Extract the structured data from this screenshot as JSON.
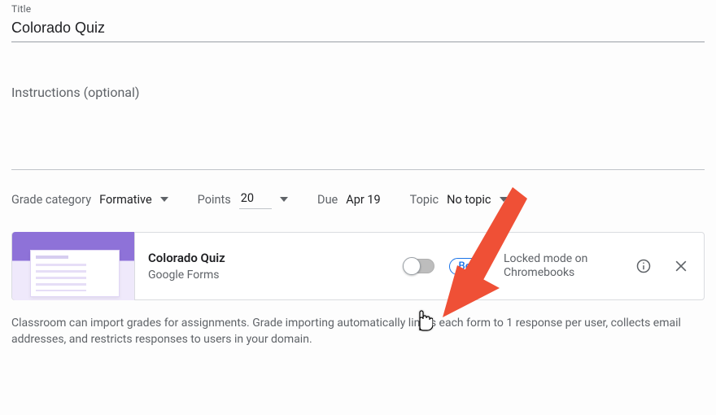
{
  "title": {
    "label": "Title",
    "value": "Colorado Quiz"
  },
  "instructions": {
    "placeholder": "Instructions (optional)"
  },
  "meta": {
    "gradeCategory": {
      "label": "Grade category",
      "value": "Formative"
    },
    "points": {
      "label": "Points",
      "value": "20"
    },
    "due": {
      "label": "Due",
      "value": "Apr 19"
    },
    "topic": {
      "label": "Topic",
      "value": "No topic"
    }
  },
  "attachment": {
    "title": "Colorado Quiz",
    "subtitle": "Google Forms",
    "betaBadge": "Beta",
    "lockedModeLabel": "Locked mode on Chromebooks"
  },
  "helpText": "Classroom can import grades for assignments. Grade importing automatically limits each form to 1 response per user, collects email addresses, and restricts responses to users in your domain."
}
